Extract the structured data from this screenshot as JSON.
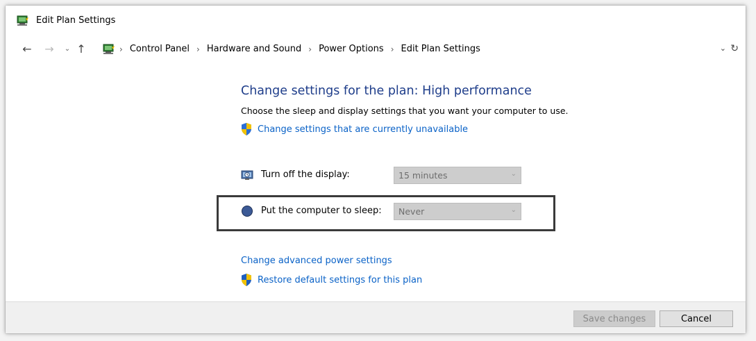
{
  "window": {
    "title": "Edit Plan Settings"
  },
  "nav": {
    "back_icon": "arrow-left-icon",
    "forward_icon": "arrow-right-icon",
    "recent_icon": "chevron-down-icon",
    "up_icon": "arrow-up-icon",
    "refresh_icon": "refresh-icon"
  },
  "breadcrumb": {
    "items": [
      "Control Panel",
      "Hardware and Sound",
      "Power Options",
      "Edit Plan Settings"
    ],
    "separator": "›"
  },
  "main": {
    "heading": "Change settings for the plan: High performance",
    "description": "Choose the sleep and display settings that you want your computer to use.",
    "unavailable_link": "Change settings that are currently unavailable",
    "settings": [
      {
        "label": "Turn off the display:",
        "value": "15 minutes",
        "icon": "display-timer-icon"
      },
      {
        "label": "Put the computer to sleep:",
        "value": "Never",
        "icon": "sleep-moon-icon"
      }
    ],
    "advanced_link": "Change advanced power settings",
    "restore_link": "Restore default settings for this plan"
  },
  "footer": {
    "save_label": "Save changes",
    "cancel_label": "Cancel"
  },
  "colors": {
    "heading": "#1e3d8a",
    "link": "#0a62c7",
    "select_disabled": "#cdcdcd"
  }
}
